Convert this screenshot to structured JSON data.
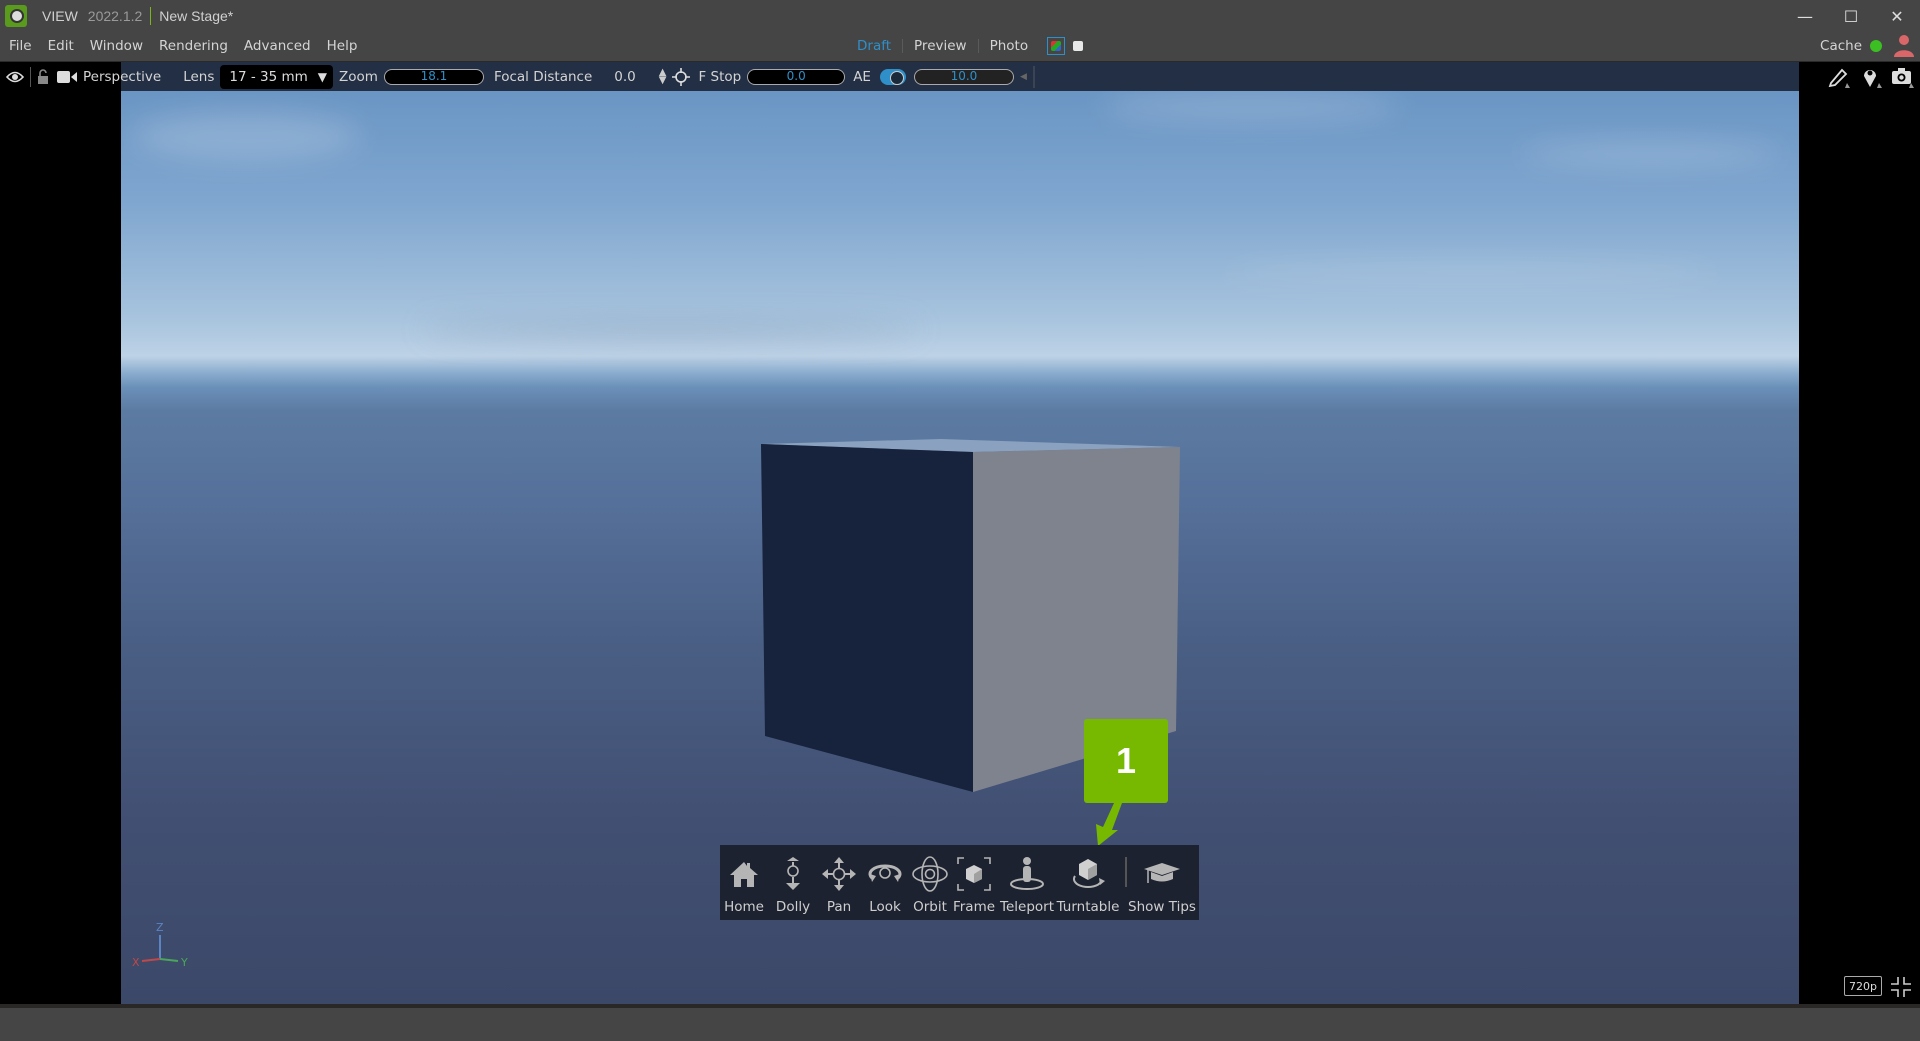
{
  "window": {
    "app_name": "VIEW",
    "version": "2022.1.2",
    "document": "New Stage*",
    "controls": {
      "minimize": "—",
      "maximize": "☐",
      "close": "✕"
    }
  },
  "menu": [
    "File",
    "Edit",
    "Window",
    "Rendering",
    "Advanced",
    "Help"
  ],
  "render_modes": {
    "items": [
      {
        "label": "Draft",
        "active": true
      },
      {
        "label": "Preview",
        "active": false
      },
      {
        "label": "Photo",
        "active": false
      }
    ],
    "accent_color": "#2f8fc9"
  },
  "cache": {
    "label": "Cache",
    "status_color": "#3cbf22"
  },
  "viewport_toolbar": {
    "camera": "Perspective",
    "lens_label": "Lens",
    "lens_value": "17 - 35 mm",
    "zoom_label": "Zoom",
    "zoom_value": "18.1",
    "focal_distance_label": "Focal Distance",
    "focal_distance_value": "0.0",
    "fstop_label": "F Stop",
    "fstop_value": "0.0",
    "ae_label": "AE",
    "ae_enabled": true,
    "exposure_value": "10.0"
  },
  "navigation": {
    "items": [
      {
        "label": "Home",
        "icon": "home-icon"
      },
      {
        "label": "Dolly",
        "icon": "dolly-icon"
      },
      {
        "label": "Pan",
        "icon": "pan-icon"
      },
      {
        "label": "Look",
        "icon": "look-icon"
      },
      {
        "label": "Orbit",
        "icon": "orbit-icon"
      },
      {
        "label": "Frame",
        "icon": "frame-icon"
      },
      {
        "label": "Teleport",
        "icon": "teleport-icon"
      },
      {
        "label": "Turntable",
        "icon": "turntable-icon"
      },
      {
        "label": "Show Tips",
        "icon": "graduation-cap-icon"
      }
    ]
  },
  "callout": {
    "number": "1",
    "color": "#76b900"
  },
  "axis_gizmo": {
    "x": "X",
    "y": "Y",
    "z": "Z"
  },
  "resolution_badge": "720p"
}
